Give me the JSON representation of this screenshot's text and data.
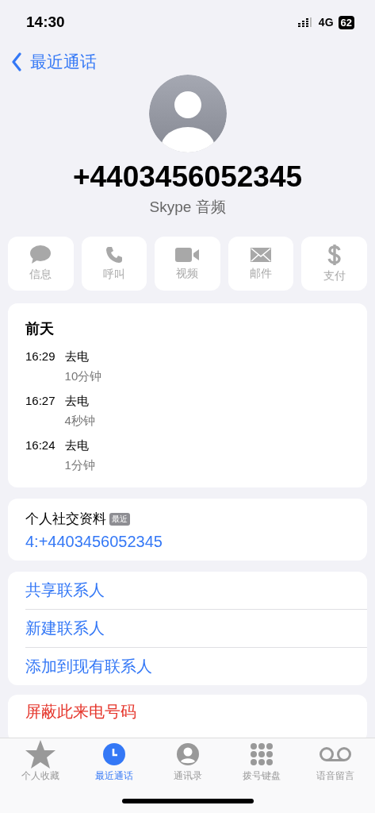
{
  "status_bar": {
    "time": "14:30",
    "network": "4G",
    "battery": "62"
  },
  "nav": {
    "back_label": "最近通话"
  },
  "contact": {
    "number": "+4403456052345",
    "subtitle": "Skype 音频"
  },
  "actions": [
    {
      "kind": "message",
      "label": "信息",
      "disabled": true
    },
    {
      "kind": "call",
      "label": "呼叫",
      "disabled": true
    },
    {
      "kind": "video",
      "label": "视频",
      "disabled": true
    },
    {
      "kind": "mail",
      "label": "邮件",
      "disabled": true
    },
    {
      "kind": "pay",
      "label": "支付",
      "disabled": true
    }
  ],
  "call_history": {
    "date": "前天",
    "calls": [
      {
        "time": "16:29",
        "type": "去电",
        "duration": "10分钟"
      },
      {
        "time": "16:27",
        "type": "去电",
        "duration": "4秒钟"
      },
      {
        "time": "16:24",
        "type": "去电",
        "duration": "1分钟"
      }
    ]
  },
  "social_profile": {
    "title": "个人社交资料",
    "badge": "最近",
    "value": "4:+4403456052345"
  },
  "contact_actions": [
    "共享联系人",
    "新建联系人",
    "添加到现有联系人"
  ],
  "block_action": "屏蔽此来电号码",
  "tab_bar": [
    {
      "kind": "favorites",
      "label": "个人收藏",
      "selected": false
    },
    {
      "kind": "recents",
      "label": "最近通话",
      "selected": true
    },
    {
      "kind": "contacts",
      "label": "通讯录",
      "selected": false
    },
    {
      "kind": "keypad",
      "label": "拨号键盘",
      "selected": false
    },
    {
      "kind": "voicemail",
      "label": "语音留言",
      "selected": false
    }
  ]
}
